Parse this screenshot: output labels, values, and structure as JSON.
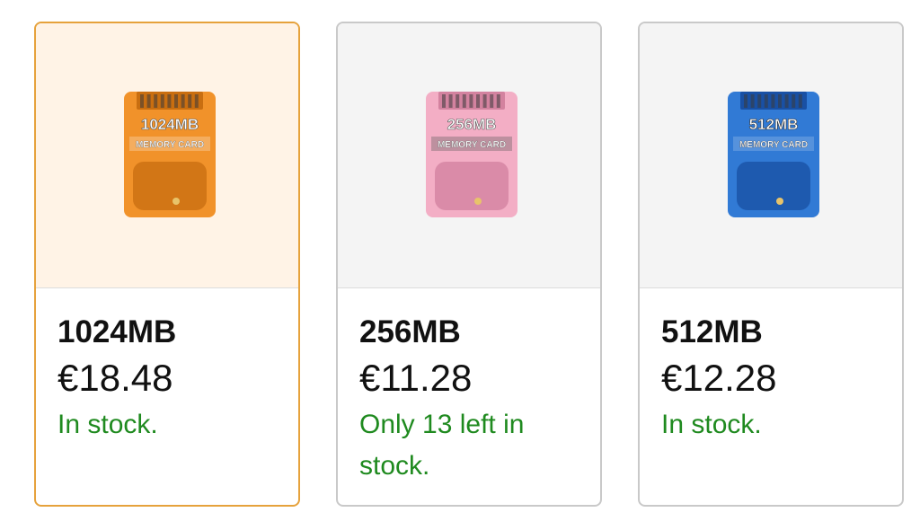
{
  "products": [
    {
      "name": "1024MB",
      "price": "€18.48",
      "stock": "In stock.",
      "card_label_top": "1024MB",
      "card_label_bottom": "MEMORY CARD",
      "card_color": "#f08a1a",
      "card_color_dark": "#b85f05",
      "selected": true
    },
    {
      "name": "256MB",
      "price": "€11.28",
      "stock": "Only 13 left in stock.",
      "card_label_top": "256MB",
      "card_label_bottom": "MEMORY CARD",
      "card_color": "#f2a7c0",
      "card_color_dark": "#c56f8f",
      "selected": false
    },
    {
      "name": "512MB",
      "price": "€12.28",
      "stock": "In stock.",
      "card_label_top": "512MB",
      "card_label_bottom": "MEMORY CARD",
      "card_color": "#1f6fd1",
      "card_color_dark": "#0f3f8f",
      "selected": false
    }
  ],
  "colors": {
    "stock_green": "#1f8a1f",
    "selected_border": "#e6a23c"
  }
}
